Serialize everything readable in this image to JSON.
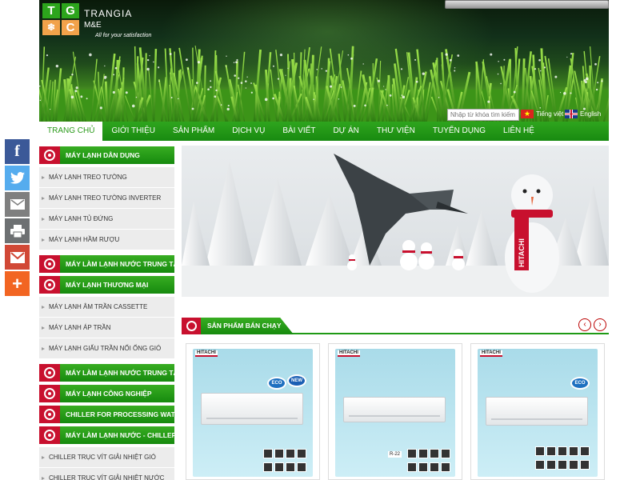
{
  "brand": {
    "box_letters": [
      "T",
      "G",
      "❄",
      "C"
    ],
    "name_line1": "TRANGIA",
    "name_line2": "M&E",
    "slogan": "All for your satisfaction"
  },
  "header": {
    "search_placeholder": "Nhập từ khóa tìm kiếm",
    "lang_vi": "Tiếng việt",
    "lang_en": "English"
  },
  "nav": {
    "items": [
      "TRANG CHỦ",
      "GIỚI THIỆU",
      "SẢN PHẨM",
      "DỊCH VỤ",
      "BÀI VIẾT",
      "DỰ ÁN",
      "THƯ VIỆN",
      "TUYỂN DỤNG",
      "LIÊN HỆ"
    ]
  },
  "social": {
    "facebook": "f",
    "plus": "+"
  },
  "sidebar": {
    "cat1": "MÁY LẠNH DÂN DỤNG",
    "cat1_items": [
      "MÁY LẠNH TREO TƯỜNG",
      "MÁY LẠNH TREO TƯỜNG INVERTER",
      "MÁY LẠNH TỦ ĐỨNG",
      "MÁY LẠNH HẦM RƯỢU"
    ],
    "cat2": "MÁY LÀM LẠNH NƯỚC TRUNG TÂM",
    "cat3": "MÁY LẠNH THƯƠNG MẠI",
    "cat3_items": [
      "MÁY LẠNH ÂM TRẦN CASSETTE",
      "MÁY LẠNH ÁP TRẦN",
      "MÁY LẠNH GIẤU TRẦN NỐI ỐNG GIÓ"
    ],
    "cat4": "MÁY LÀM LẠNH NƯỚC TRUNG TÂM",
    "cat5": "MÁY LẠNH CÔNG NGHIỆP",
    "cat6": "CHILLER FOR PROCESSING WATER",
    "cat7": "MÁY LÀM LẠNH NƯỚC - CHILLER",
    "cat7_items": [
      "CHILLER TRỤC VÍT GIẢI NHIỆT GIÓ",
      "CHILLER TRỤC VÍT GIẢI NHIỆT NƯỚC"
    ]
  },
  "slider": {
    "scarf_text": "HITACHI"
  },
  "featured": {
    "title": "SẢN PHẨM BÁN CHẠY",
    "prev": "‹",
    "next": "›",
    "products": [
      {
        "brand": "HITACHI",
        "badge1": "ECO",
        "badge2": "NEW"
      },
      {
        "brand": "HITACHI",
        "label": "R-22"
      },
      {
        "brand": "HITACHI",
        "badge1": "ECO"
      }
    ]
  },
  "colors": {
    "green": "#1f9a15",
    "red": "#c8102e",
    "facebook": "#3b5998",
    "twitter": "#55acee",
    "email": "#7f7f7f",
    "print": "#6d7072",
    "gmail": "#d14836",
    "plus": "#f26522"
  }
}
